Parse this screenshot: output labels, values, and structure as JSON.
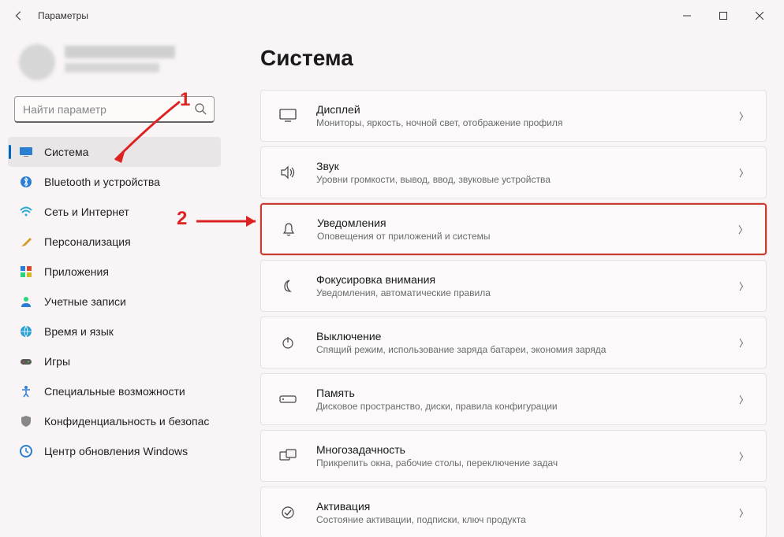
{
  "titlebar": {
    "title": "Параметры"
  },
  "search": {
    "placeholder": "Найти параметр"
  },
  "sidebar": {
    "items": [
      {
        "label": "Система",
        "selected": true
      },
      {
        "label": "Bluetooth и устройства"
      },
      {
        "label": "Сеть и Интернет"
      },
      {
        "label": "Персонализация"
      },
      {
        "label": "Приложения"
      },
      {
        "label": "Учетные записи"
      },
      {
        "label": "Время и язык"
      },
      {
        "label": "Игры"
      },
      {
        "label": "Специальные возможности"
      },
      {
        "label": "Конфиденциальность и безопас"
      },
      {
        "label": "Центр обновления Windows"
      }
    ]
  },
  "main": {
    "heading": "Система",
    "cards": [
      {
        "title": "Дисплей",
        "desc": "Мониторы, яркость, ночной свет, отображение профиля"
      },
      {
        "title": "Звук",
        "desc": "Уровни громкости, вывод, ввод, звуковые устройства"
      },
      {
        "title": "Уведомления",
        "desc": "Оповещения от приложений и системы",
        "highlight": true
      },
      {
        "title": "Фокусировка внимания",
        "desc": "Уведомления, автоматические правила"
      },
      {
        "title": "Выключение",
        "desc": "Спящий режим, использование заряда батареи, экономия заряда"
      },
      {
        "title": "Память",
        "desc": "Дисковое пространство, диски, правила конфигурации"
      },
      {
        "title": "Многозадачность",
        "desc": "Прикрепить окна, рабочие столы, переключение задач"
      },
      {
        "title": "Активация",
        "desc": "Состояние активации, подписки, ключ продукта"
      }
    ]
  },
  "annotations": {
    "one": "1",
    "two": "2"
  }
}
